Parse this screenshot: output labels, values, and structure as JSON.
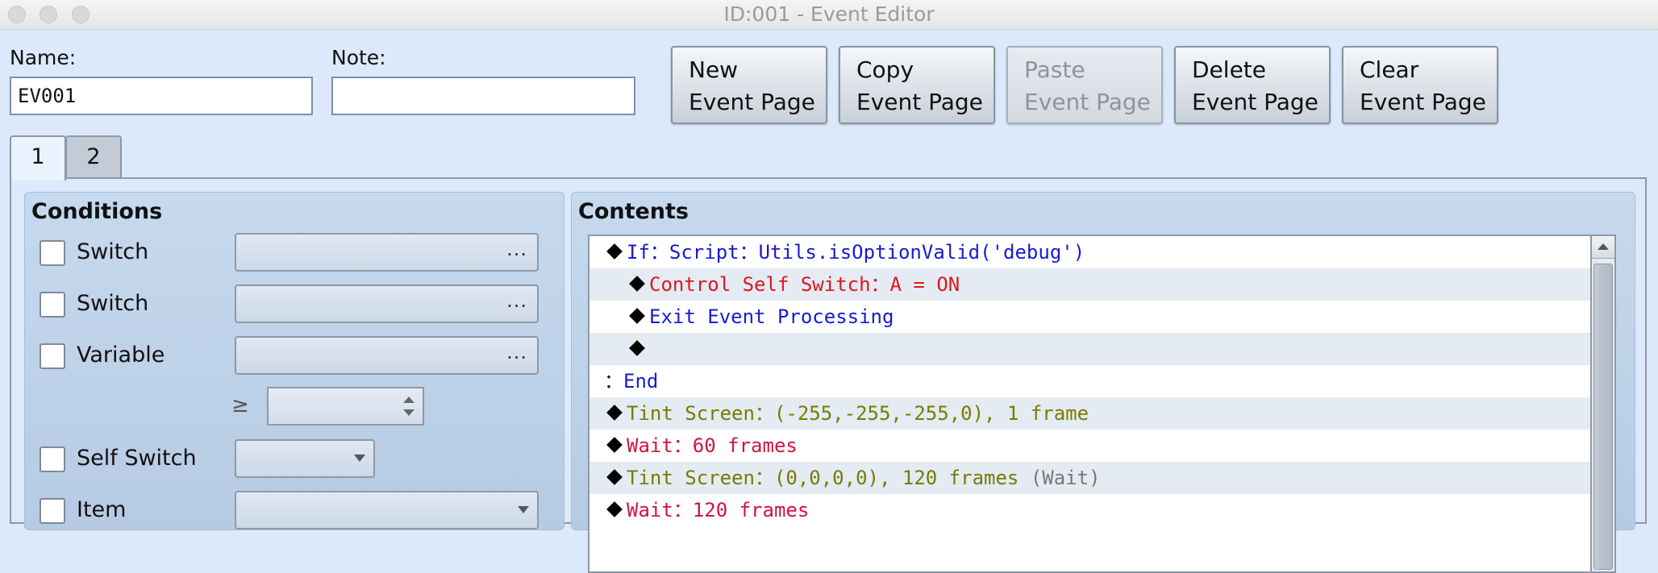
{
  "window": {
    "title": "ID:001 - Event Editor"
  },
  "name_field": {
    "label": "Name:",
    "value": "EV001"
  },
  "note_field": {
    "label": "Note:",
    "value": ""
  },
  "buttons": [
    {
      "line1": "New",
      "line2": "Event Page",
      "enabled": true
    },
    {
      "line1": "Copy",
      "line2": "Event Page",
      "enabled": true
    },
    {
      "line1": "Paste",
      "line2": "Event Page",
      "enabled": false
    },
    {
      "line1": "Delete",
      "line2": "Event Page",
      "enabled": true
    },
    {
      "line1": "Clear",
      "line2": "Event Page",
      "enabled": true
    }
  ],
  "tabs": [
    {
      "label": "1",
      "active": true
    },
    {
      "label": "2",
      "active": false
    }
  ],
  "conditions": {
    "title": "Conditions",
    "rows": [
      {
        "label": "Switch",
        "checked": false,
        "value": "",
        "picker_icon": "dots"
      },
      {
        "label": "Switch",
        "checked": false,
        "value": "",
        "picker_icon": "dots"
      },
      {
        "label": "Variable",
        "checked": false,
        "value": "",
        "picker_icon": "dots"
      },
      {
        "label": "Self Switch",
        "checked": false,
        "value": "",
        "picker_icon": "dropdown"
      },
      {
        "label": "Item",
        "checked": false,
        "value": "",
        "picker_icon": "dropdown"
      }
    ],
    "picker_dots": "...",
    "variable_compare": {
      "operator": "≥",
      "value": ""
    }
  },
  "contents": {
    "title": "Contents",
    "lines": [
      {
        "indent": 0,
        "marker": "diamond",
        "segments": [
          {
            "text": "If：Script：Utils.isOptionValid('debug')",
            "color": "blue"
          }
        ]
      },
      {
        "indent": 1,
        "marker": "diamond",
        "segments": [
          {
            "text": "Control Self Switch：A = ON",
            "color": "red"
          }
        ]
      },
      {
        "indent": 1,
        "marker": "diamond",
        "segments": [
          {
            "text": "Exit Event Processing",
            "color": "blue"
          }
        ]
      },
      {
        "indent": 1,
        "marker": "diamond",
        "segments": []
      },
      {
        "indent": 0,
        "marker": "colon",
        "segments": [
          {
            "text": "End",
            "color": "blue"
          }
        ]
      },
      {
        "indent": 0,
        "marker": "diamond",
        "segments": [
          {
            "text": "Tint Screen：(-255,-255,-255,0), 1 frame",
            "color": "olive"
          }
        ]
      },
      {
        "indent": 0,
        "marker": "diamond",
        "segments": [
          {
            "text": "Wait：60 frames",
            "color": "crimson"
          }
        ]
      },
      {
        "indent": 0,
        "marker": "diamond",
        "segments": [
          {
            "text": "Tint Screen：(0,0,0,0), 120 frames ",
            "color": "olive"
          },
          {
            "text": "(Wait)",
            "color": "gray"
          }
        ]
      },
      {
        "indent": 0,
        "marker": "diamond",
        "segments": [
          {
            "text": "Wait：120 frames",
            "color": "crimson"
          }
        ]
      }
    ],
    "colon_marker": "："
  }
}
